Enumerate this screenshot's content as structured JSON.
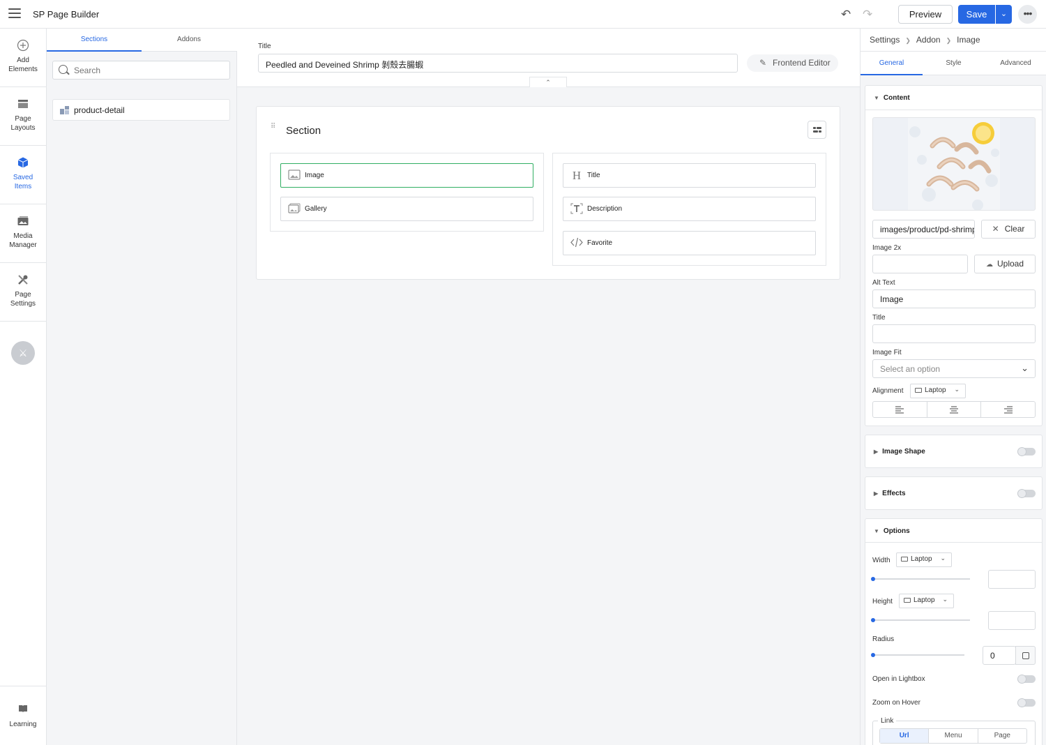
{
  "app": {
    "title": "SP Page Builder"
  },
  "topbar": {
    "preview_label": "Preview",
    "save_label": "Save"
  },
  "leftbar": {
    "items": [
      {
        "label1": "Add",
        "label2": "Elements",
        "icon": "plus-circle-icon"
      },
      {
        "label1": "Page",
        "label2": "Layouts",
        "icon": "layout-icon"
      },
      {
        "label1": "Saved",
        "label2": "Items",
        "icon": "box-icon"
      },
      {
        "label1": "Media",
        "label2": "Manager",
        "icon": "media-icon"
      },
      {
        "label1": "Page",
        "label2": "Settings",
        "icon": "tools-icon"
      }
    ],
    "learning_label": "Learning"
  },
  "panel": {
    "tabs": [
      "Sections",
      "Addons"
    ],
    "search_placeholder": "Search",
    "items": [
      "product-detail"
    ]
  },
  "titlebar": {
    "label": "Title",
    "value": "Peedled and Deveined Shrimp 剝殼去腸蝦",
    "frontend_editor_label": "Frontend Editor"
  },
  "section": {
    "title": "Section",
    "left_col": [
      "Image",
      "Gallery"
    ],
    "right_col": [
      "Title",
      "Description",
      "Favorite"
    ]
  },
  "rpanel": {
    "breadcrumb": [
      "Settings",
      "Addon",
      "Image"
    ],
    "tabs": [
      "General",
      "Style",
      "Advanced"
    ],
    "content": {
      "header": "Content",
      "image_path": "images/product/pd-shrimp.jpg",
      "clear_label": "Clear",
      "image2x_label": "Image 2x",
      "image2x_value": "",
      "upload_label": "Upload",
      "alt_label": "Alt Text",
      "alt_value": "Image",
      "title_label": "Title",
      "title_value": "",
      "fit_label": "Image Fit",
      "fit_placeholder": "Select an option",
      "alignment_label": "Alignment",
      "device": "Laptop"
    },
    "image_shape_label": "Image Shape",
    "effects_label": "Effects",
    "options": {
      "header": "Options",
      "width_label": "Width",
      "height_label": "Height",
      "radius_label": "Radius",
      "radius_value": "0",
      "lightbox_label": "Open in Lightbox",
      "zoom_label": "Zoom on Hover",
      "link_label": "Link",
      "link_tabs": [
        "Url",
        "Menu",
        "Page"
      ],
      "device": "Laptop"
    }
  },
  "colors": {
    "accent": "#2768e3",
    "selected": "#2fae62"
  }
}
